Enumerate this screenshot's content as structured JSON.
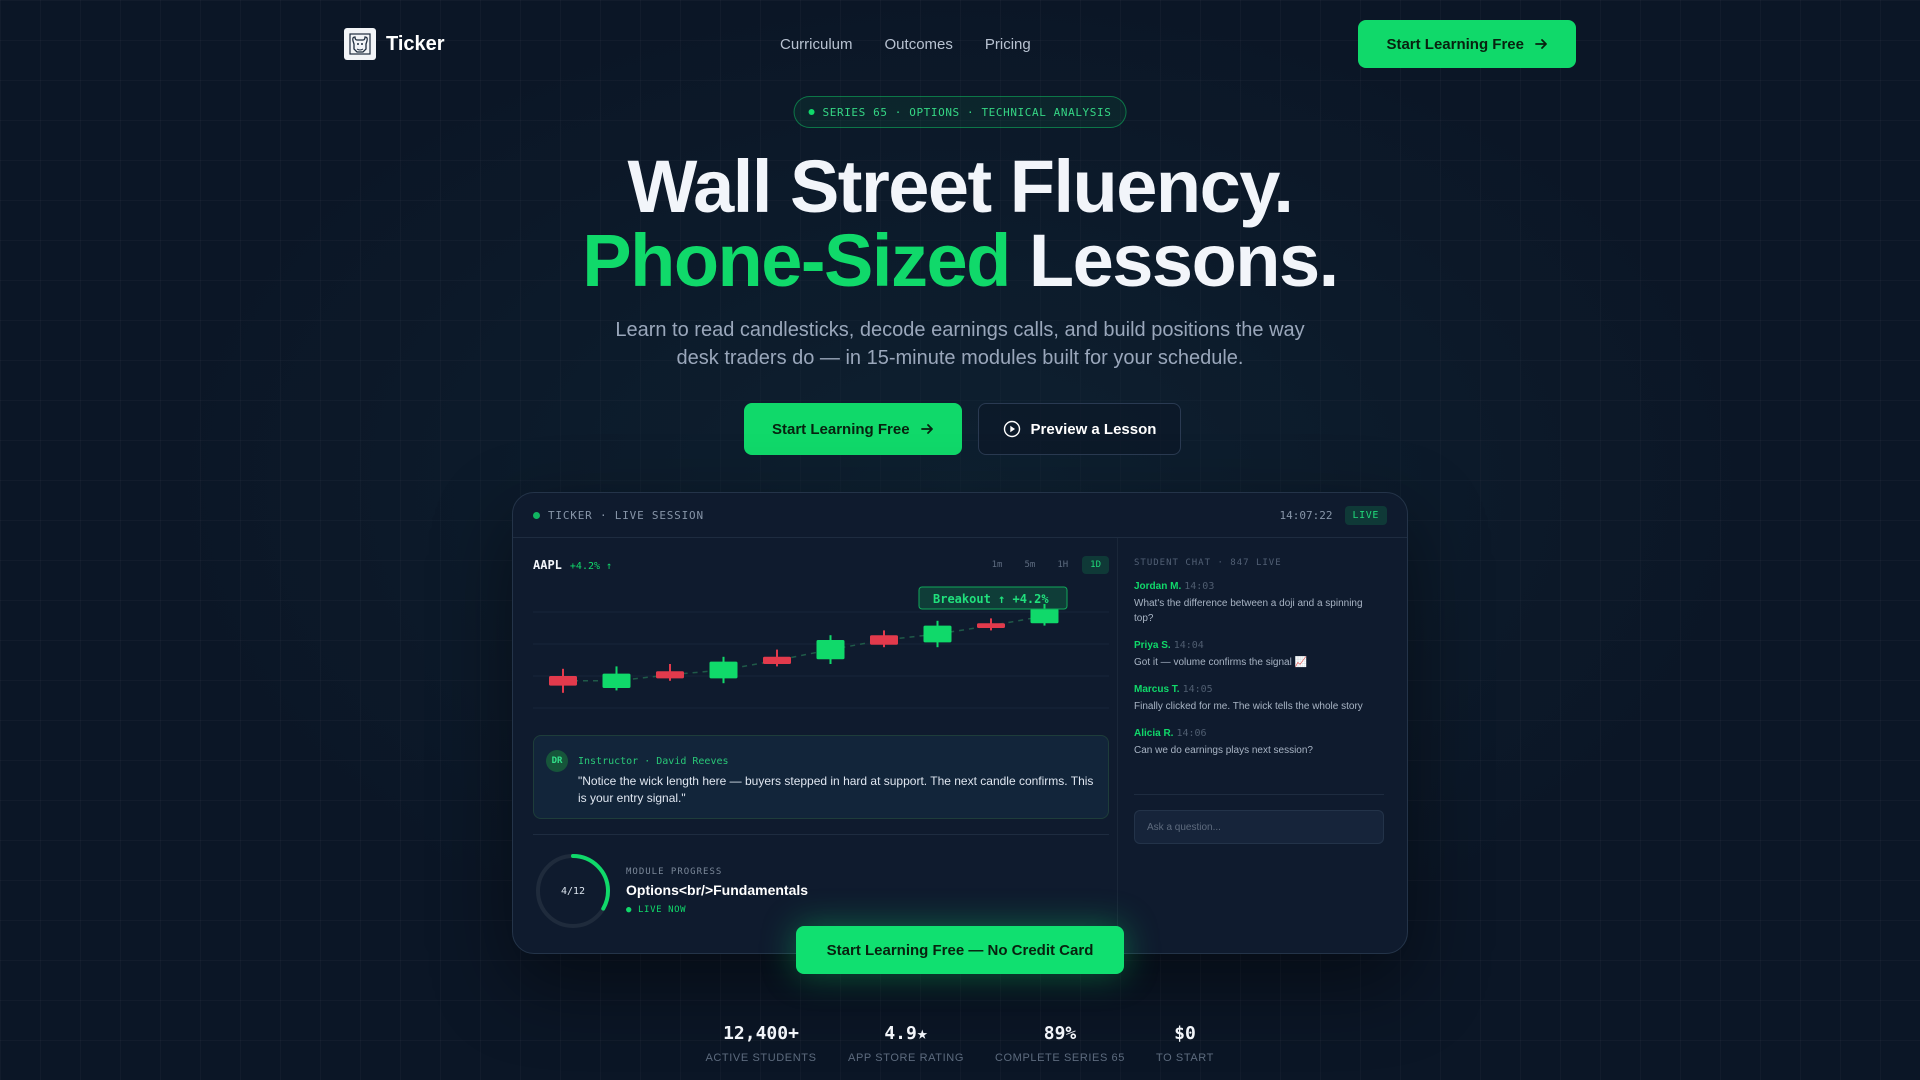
{
  "brand": {
    "name": "Ticker",
    "logo_icon": "bull-logo-icon"
  },
  "nav": {
    "links": [
      "Curriculum",
      "Outcomes",
      "Pricing"
    ],
    "cta": "Start Learning Free"
  },
  "hero": {
    "badge": "SERIES 65 · OPTIONS · TECHNICAL ANALYSIS",
    "headline_line1": "Wall Street Fluency.",
    "headline_accent": "Phone-Sized",
    "headline_line2_rest": " Lessons.",
    "subhead": "Learn to read candlesticks, decode earnings calls, and build positions the way desk traders do — in 15-minute modules built for your schedule.",
    "primary_cta": "Start Learning Free",
    "secondary_cta": "Preview a Lesson"
  },
  "session": {
    "title": "TICKER · LIVE SESSION",
    "clock": "14:07:22",
    "live_badge": "LIVE",
    "ticker_symbol": "AAPL",
    "ticker_change": "+4.2% ↑",
    "timeframes": [
      "1m",
      "5m",
      "1H",
      "1D"
    ],
    "active_timeframe": "1D",
    "breakout_label": "Breakout ↑ +4.2%",
    "candles": [
      {
        "open": 30,
        "close": 26,
        "high": 33,
        "low": 23
      },
      {
        "open": 25,
        "close": 31,
        "high": 34,
        "low": 24
      },
      {
        "open": 32,
        "close": 29,
        "high": 35,
        "low": 28
      },
      {
        "open": 29,
        "close": 36,
        "high": 38,
        "low": 27
      },
      {
        "open": 38,
        "close": 35,
        "high": 41,
        "low": 34
      },
      {
        "open": 37,
        "close": 45,
        "high": 47,
        "low": 35
      },
      {
        "open": 47,
        "close": 43,
        "high": 49,
        "low": 42
      },
      {
        "open": 44,
        "close": 51,
        "high": 53,
        "low": 42
      },
      {
        "open": 52,
        "close": 50,
        "high": 54,
        "low": 49
      },
      {
        "open": 52,
        "close": 58,
        "high": 60,
        "low": 51
      }
    ],
    "instructor": {
      "initials": "DR",
      "name": "Instructor · David Reeves",
      "quote": "\"Notice the wick length here — buyers stepped in hard at support. The next candle confirms. This is your entry signal.\""
    },
    "progress": {
      "label": "MODULE PROGRESS",
      "count": "4/12",
      "completed": 4,
      "total": 12,
      "title": "Options<br/>Fundamentals",
      "status": "● LIVE NOW"
    },
    "chat": {
      "header": "STUDENT CHAT · 847 LIVE",
      "messages": [
        {
          "user": "Jordan M.",
          "time": "14:03",
          "text": "What's the difference between a doji and a spinning top?"
        },
        {
          "user": "Priya S.",
          "time": "14:04",
          "text": "Got it — volume confirms the signal 📈"
        },
        {
          "user": "Marcus T.",
          "time": "14:05",
          "text": "Finally clicked for me. The wick tells the whole story"
        },
        {
          "user": "Alicia R.",
          "time": "14:06",
          "text": "Can we do earnings plays next session?"
        }
      ],
      "input_placeholder": "Ask a question..."
    }
  },
  "floating_cta": "Start Learning Free — No Credit Card",
  "stats": [
    {
      "value": "12,400+",
      "label": "ACTIVE STUDENTS"
    },
    {
      "value": "4.9★",
      "label": "APP STORE RATING"
    },
    {
      "value": "89%",
      "label": "COMPLETE SERIES 65"
    },
    {
      "value": "$0",
      "label": "TO START"
    }
  ],
  "colors": {
    "accent": "#10d96a",
    "bearish": "#e23a4c",
    "background": "#0b1626",
    "panel": "#0f1b2e"
  }
}
